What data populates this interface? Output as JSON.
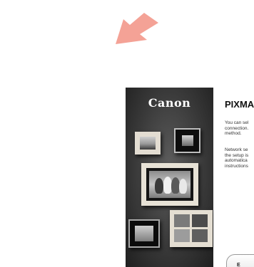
{
  "pointer": {
    "icon": "arrow-down-left-icon",
    "color": "#f4a296"
  },
  "window": {
    "brand": "Canon",
    "title": "PIXMA",
    "paragraphs": [
      "You can sel\nconnection.\nmethod.",
      "Network se\nthe setup is\nautomatica\ninstructions"
    ],
    "button_label": "E"
  }
}
